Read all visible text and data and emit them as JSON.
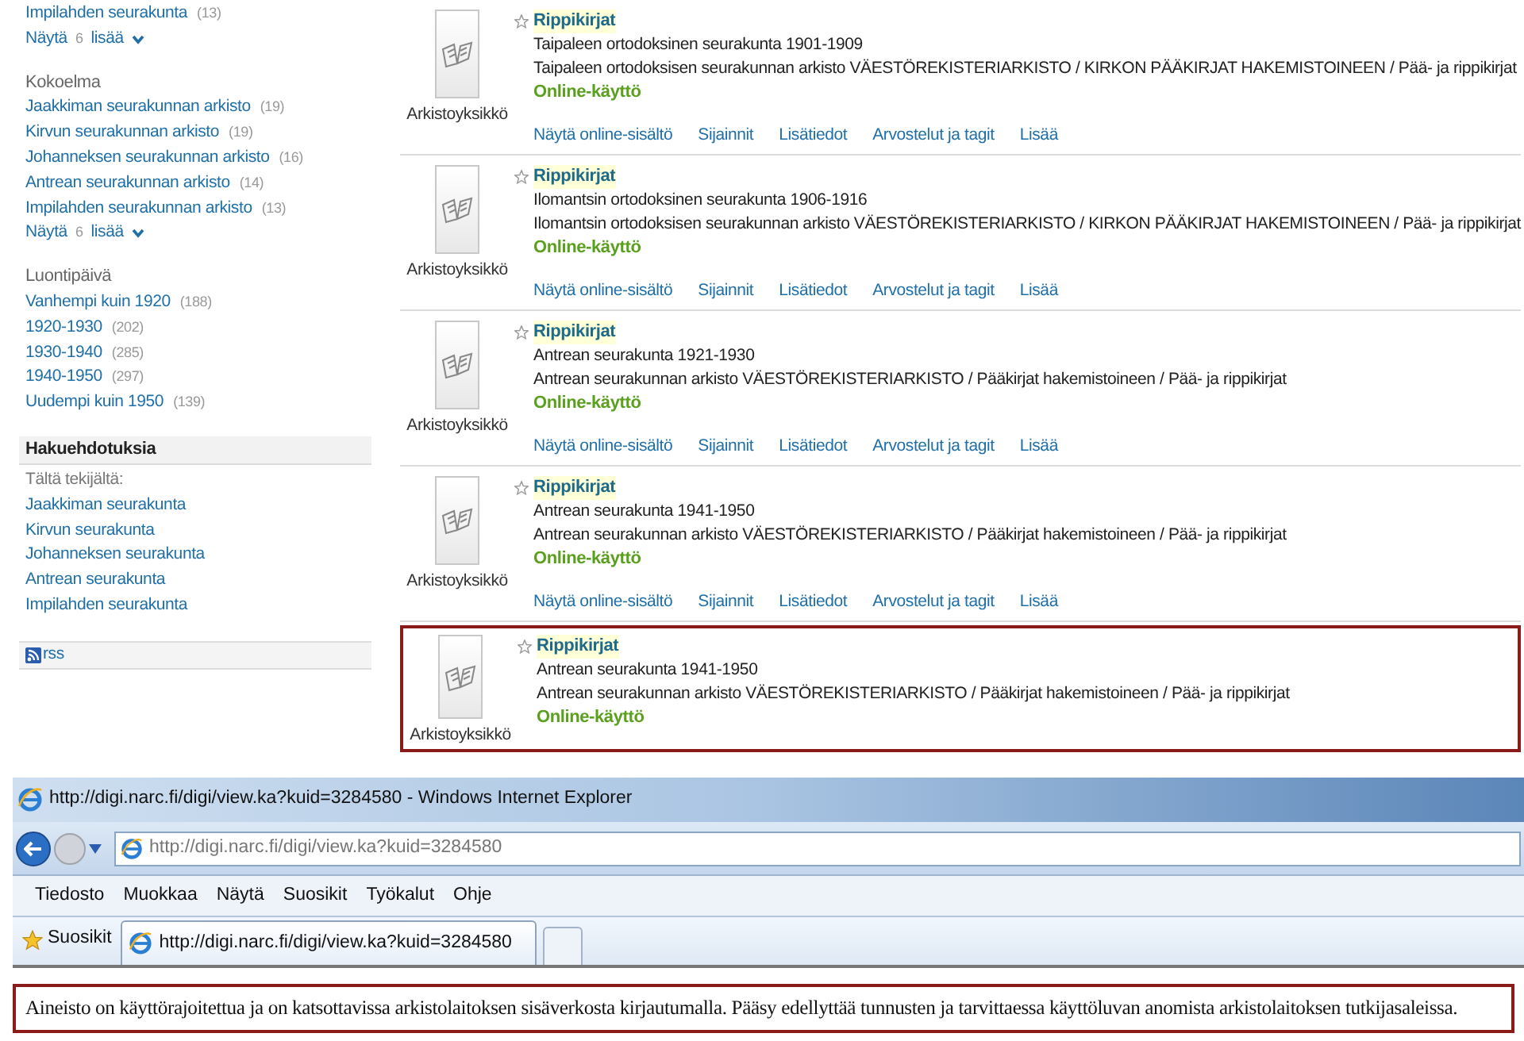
{
  "sidebar": {
    "facets": [
      {
        "items": [
          {
            "label": "Impilahden seurakunta",
            "count": "(13)"
          }
        ],
        "more": {
          "label": "Näytä",
          "count": "6",
          "suffix": "lisää"
        }
      },
      {
        "heading": "Kokoelma",
        "items": [
          {
            "label": "Jaakkiman seurakunnan arkisto",
            "count": "(19)"
          },
          {
            "label": "Kirvun seurakunnan arkisto",
            "count": "(19)"
          },
          {
            "label": "Johanneksen seurakunnan arkisto",
            "count": "(16)"
          },
          {
            "label": "Antrean seurakunnan arkisto",
            "count": "(14)"
          },
          {
            "label": "Impilahden seurakunnan arkisto",
            "count": "(13)"
          }
        ],
        "more": {
          "label": "Näytä",
          "count": "6",
          "suffix": "lisää"
        }
      },
      {
        "heading": "Luontipäivä",
        "items": [
          {
            "label": "Vanhempi kuin 1920",
            "count": "(188)"
          },
          {
            "label": "1920-1930",
            "count": "(202)"
          },
          {
            "label": "1930-1940",
            "count": "(285)"
          },
          {
            "label": "1940-1950",
            "count": "(297)"
          },
          {
            "label": "Uudempi kuin 1950",
            "count": "(139)"
          }
        ]
      }
    ],
    "suggestions": {
      "title": "Hakuehdotuksia",
      "subtitle": "Tältä tekijältä:",
      "items": [
        "Jaakkiman seurakunta",
        "Kirvun seurakunta",
        "Johanneksen seurakunta",
        "Antrean seurakunta",
        "Impilahden seurakunta"
      ]
    },
    "rss": "rss"
  },
  "results": [
    {
      "format": "Arkistoyksikkö",
      "title": "Rippikirjat",
      "subtitle": "Taipaleen ortodoksinen seurakunta 1901-1909",
      "path": "Taipaleen ortodoksisen seurakunnan arkisto VÄESTÖREKISTERIARKISTO / KIRKON PÄÄKIRJAT HAKEMISTOINEEN / Pää- ja rippikirjat",
      "access": "Online-käyttö",
      "highlighted": false,
      "actions": [
        "Näytä online-sisältö",
        "Sijainnit",
        "Lisätiedot",
        "Arvostelut ja tagit",
        "Lisää"
      ]
    },
    {
      "format": "Arkistoyksikkö",
      "title": "Rippikirjat",
      "subtitle": "Ilomantsin ortodoksinen seurakunta 1906-1916",
      "path": "Ilomantsin ortodoksisen seurakunnan arkisto VÄESTÖREKISTERIARKISTO / KIRKON PÄÄKIRJAT HAKEMISTOINEEN / Pää- ja rippikirjat",
      "access": "Online-käyttö",
      "highlighted": false,
      "actions": [
        "Näytä online-sisältö",
        "Sijainnit",
        "Lisätiedot",
        "Arvostelut ja tagit",
        "Lisää"
      ]
    },
    {
      "format": "Arkistoyksikkö",
      "title": "Rippikirjat",
      "subtitle": "Antrean seurakunta 1921-1930",
      "path": "Antrean seurakunnan arkisto VÄESTÖREKISTERIARKISTO / Pääkirjat hakemistoineen / Pää- ja rippikirjat",
      "access": "Online-käyttö",
      "highlighted": false,
      "actions": [
        "Näytä online-sisältö",
        "Sijainnit",
        "Lisätiedot",
        "Arvostelut ja tagit",
        "Lisää"
      ]
    },
    {
      "format": "Arkistoyksikkö",
      "title": "Rippikirjat",
      "subtitle": "Antrean seurakunta 1941-1950",
      "path": "Antrean seurakunnan arkisto VÄESTÖREKISTERIARKISTO / Pääkirjat hakemistoineen / Pää- ja rippikirjat",
      "access": "Online-käyttö",
      "highlighted": false,
      "actions": [
        "Näytä online-sisältö",
        "Sijainnit",
        "Lisätiedot",
        "Arvostelut ja tagit",
        "Lisää"
      ]
    },
    {
      "format": "Arkistoyksikkö",
      "title": "Rippikirjat",
      "subtitle": "Antrean seurakunta 1941-1950",
      "path": "Antrean seurakunnan arkisto VÄESTÖREKISTERIARKISTO / Pääkirjat hakemistoineen / Pää- ja rippikirjat",
      "access": "Online-käyttö",
      "highlighted": true
    }
  ],
  "browser": {
    "title": "http://digi.narc.fi/digi/view.ka?kuid=3284580 - Windows Internet Explorer",
    "address": "http://digi.narc.fi/digi/view.ka?kuid=3284580",
    "menu": [
      "Tiedosto",
      "Muokkaa",
      "Näytä",
      "Suosikit",
      "Työkalut",
      "Ohje"
    ],
    "favorites": "Suosikit",
    "tab": "http://digi.narc.fi/digi/view.ka?kuid=3284580"
  },
  "notice": "Aineisto on käyttörajoitettua ja on katsottavissa arkistolaitoksen sisäverkosta kirjautumalla. Pääsy edellyttää tunnusten ja tarvittaessa käyttöluvan anomista arkistolaitoksen tutkijasaleissa."
}
